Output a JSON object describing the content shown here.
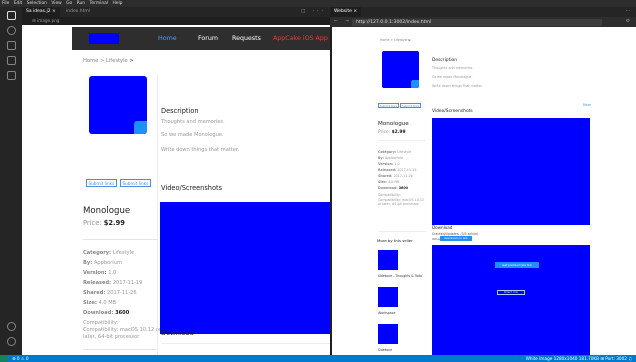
{
  "menubar": [
    "File",
    "Edit",
    "Selection",
    "View",
    "Go",
    "Run",
    "Terminal",
    "Help"
  ],
  "editor": {
    "tabs": [
      {
        "label": "Sa ideas.j2  ×"
      },
      {
        "label": "index.html"
      }
    ],
    "tab_icons": "□ ···",
    "breadcrumb": "☰ image.png"
  },
  "left_page": {
    "nav": [
      "Home",
      "Forum",
      "Requests",
      "AppCake iOS App"
    ],
    "breadcrumb_home": "Home > Lifestyle",
    "breadcrumb_sep": ">",
    "buttons": [
      "Submit links",
      "Submit links"
    ],
    "title": "Monologue",
    "price_label": "Price:",
    "price": "$2.99",
    "meta": [
      {
        "k": "Category:",
        "v": "Lifestyle"
      },
      {
        "k": "By:",
        "v": "Appborium"
      },
      {
        "k": "Version:",
        "v": "1.0"
      },
      {
        "k": "Released:",
        "v": "2017-11-19"
      },
      {
        "k": "Shared:",
        "v": "2017-11-26"
      },
      {
        "k": "Size:",
        "v": "4.0 MB"
      },
      {
        "k": "Download:",
        "v": "3600"
      }
    ],
    "compat_label": "Compatibility:",
    "compat": "Compatibility: macOS 10.12 or later, 64-bit processor",
    "description_h": "Description",
    "description_lines": [
      "Thoughts and memories.",
      "So we made Monologue.",
      "Write down things that matter."
    ],
    "video_h": "Video/Screenshots",
    "download_h": "Download"
  },
  "browser": {
    "tab": "Website  ×",
    "url": "http://127.0.0.1:3002/index.html",
    "breadcrumb": "Home > Lifestyle ▶",
    "buttons": [
      "Submit links",
      "Submit links"
    ],
    "more": "More",
    "title": "Monologue",
    "price_label": "Price:",
    "price": "$2.99",
    "meta": [
      {
        "k": "Category:",
        "v": "Lifestyle"
      },
      {
        "k": "By:",
        "v": "Appborium"
      },
      {
        "k": "Version:",
        "v": "1.0"
      },
      {
        "k": "Released:",
        "v": "2017-11-19"
      },
      {
        "k": "Shared:",
        "v": "2017-11-26"
      },
      {
        "k": "Size:",
        "v": "4.0 MB"
      },
      {
        "k": "Download:",
        "v": "3600"
      }
    ],
    "compat_label": "Compatibility:",
    "compat": "Compatibility: macOS 10.12 or later, 64-bit processor",
    "description_h": "Description",
    "description_lines": [
      "Thoughts and memories.",
      "So we made Monologue.",
      "Write down things that matter."
    ],
    "video_h": "Video/Screenshots",
    "seller_h": "More by this seller",
    "seller_apps": [
      "Sidetone - Thoughts & Todo",
      "Workspace",
      "Sidetone"
    ],
    "download_h": "Download",
    "download_sub": "Cracked/Updates: (3/5 active)",
    "download_sub2": "Other",
    "download_badge": "download on link",
    "download_btn1": "Get premium Ipa link",
    "download_btn2": "Direct .link"
  },
  "status": {
    "left": "⊗ 0 ⚠ 0",
    "right": "White Image   1280x1040   181.70KB   ⊞ Port: 3002   ♫"
  }
}
